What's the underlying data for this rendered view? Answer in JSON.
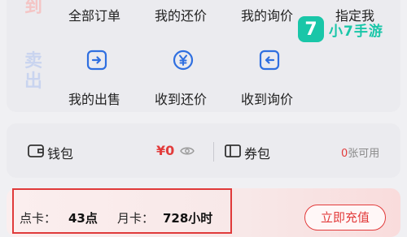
{
  "buy_section": {
    "side_label": "到",
    "items": [
      {
        "label": "全部订单"
      },
      {
        "label": "我的还价"
      },
      {
        "label": "我的询价"
      },
      {
        "label": "指定我"
      }
    ]
  },
  "sell_section": {
    "side_label_line1": "卖",
    "side_label_line2": "出",
    "items": [
      {
        "label": "我的出售",
        "icon": "sell-arrow-icon"
      },
      {
        "label": "收到还价",
        "icon": "yen-circle-icon"
      },
      {
        "label": "收到询价",
        "icon": "inquiry-arrow-icon"
      }
    ]
  },
  "logo": {
    "mark": "7",
    "text": "小7手游"
  },
  "wallet": {
    "label": "钱包",
    "amount": "¥0",
    "icon": "wallet-icon",
    "visibility_icon": "eye-icon"
  },
  "coupon": {
    "label": "券包",
    "count_number": "0",
    "count_suffix": "张可用",
    "icon": "coupon-icon"
  },
  "points": {
    "point_card_label": "点卡：",
    "point_card_value": "43点",
    "month_card_label": "月卡：",
    "month_card_value": "728小时",
    "recharge_label": "立即充值"
  },
  "colors": {
    "accent_red": "#e23b3b",
    "icon_blue": "#2f6fe0",
    "logo_green": "#19c6a8"
  }
}
